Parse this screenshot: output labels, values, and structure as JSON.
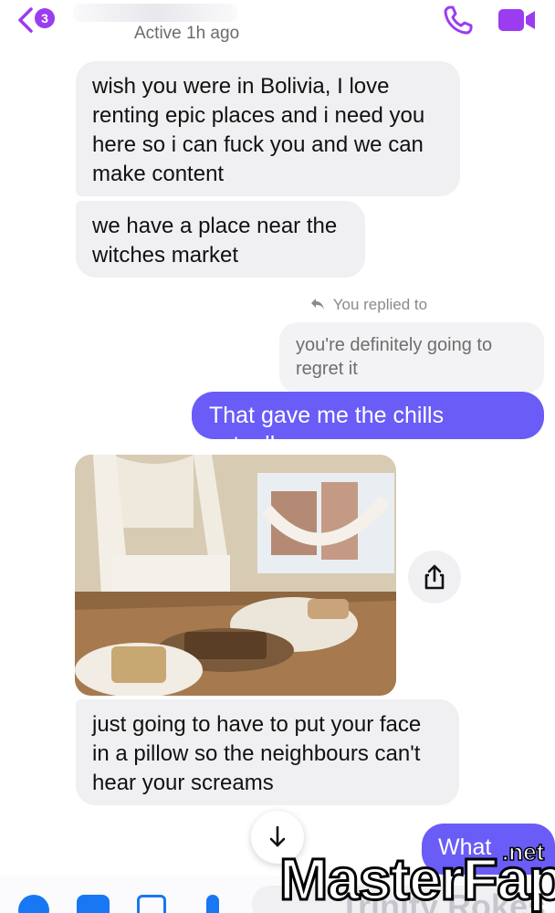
{
  "header": {
    "back_badge": "3",
    "status": "Active 1h ago"
  },
  "messages": {
    "incoming_1": "wish you were in Bolivia, I love renting epic places and i need you here so i can fuck you and we can make content",
    "incoming_2": "we have a place near the witches market",
    "reply_label": "You replied to",
    "quoted_text": "you're definitely going to regret it",
    "outgoing_1": "That gave me the chills actually",
    "incoming_3": "just going to have to put your face in a pillow so the neighbours can't hear your screams",
    "outgoing_2": "What"
  },
  "watermark": {
    "main": "MasterFap",
    "tld": ".net",
    "faint": "Trinity Rokes"
  },
  "icons": {
    "back": "chevron-left-icon",
    "phone": "phone-icon",
    "video": "video-camera-icon",
    "share": "share-icon",
    "scroll": "arrow-down-icon"
  },
  "colors": {
    "accent": "#9b3cf0",
    "outgoing_bubble": "#6a5cf6",
    "incoming_bubble": "#f0f0f2"
  }
}
